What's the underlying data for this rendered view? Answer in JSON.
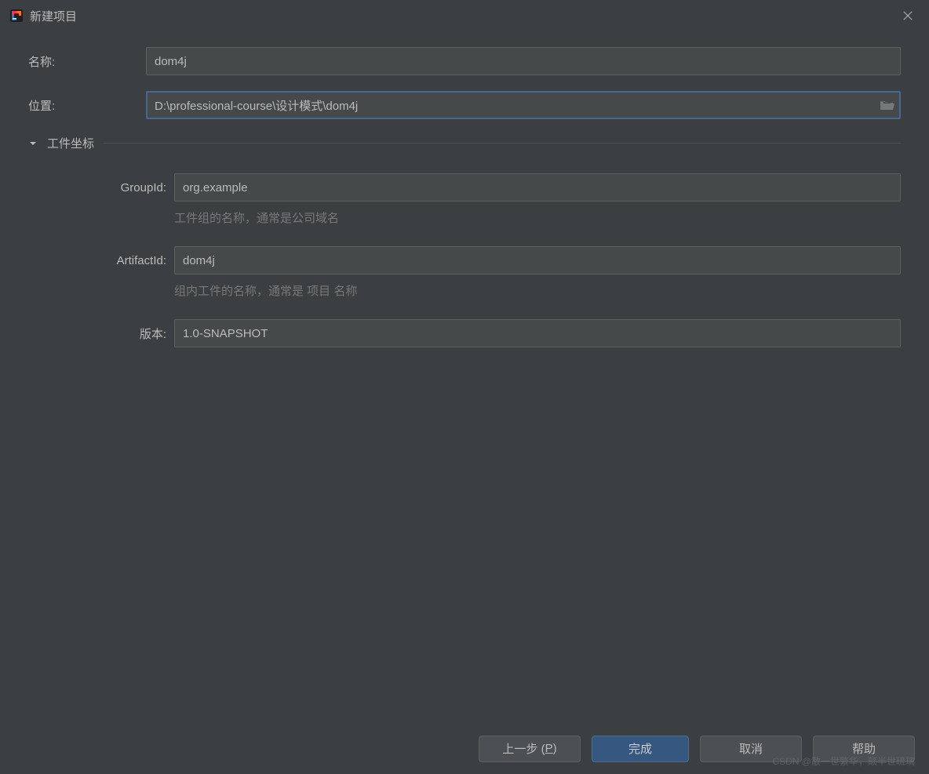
{
  "window": {
    "title": "新建项目"
  },
  "form": {
    "name_label": "名称:",
    "name_value": "dom4j",
    "location_label": "位置:",
    "location_value": "D:\\professional-course\\设计模式\\dom4j",
    "section_title": "工件坐标",
    "groupid_label": "GroupId:",
    "groupid_value": "org.example",
    "groupid_hint": "工件组的名称，通常是公司域名",
    "artifactid_label": "ArtifactId:",
    "artifactid_value": "dom4j",
    "artifactid_hint": "组内工件的名称，通常是 项目 名称",
    "version_label": "版本:",
    "version_value": "1.0-SNAPSHOT"
  },
  "buttons": {
    "previous_prefix": "上一步 (",
    "previous_mn": "P",
    "previous_suffix": ")",
    "finish": "完成",
    "cancel": "取消",
    "help": "帮助"
  },
  "watermark": "CSDN @散一世繁华，颠半世琉璃"
}
